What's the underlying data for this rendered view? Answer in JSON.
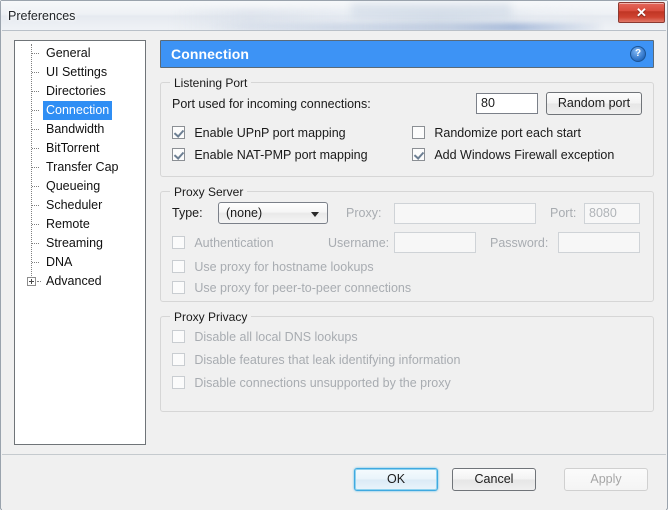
{
  "window": {
    "title": "Preferences",
    "close_label": "✕"
  },
  "sidebar": {
    "items": [
      {
        "label": "General",
        "selected": false,
        "expander": false
      },
      {
        "label": "UI Settings",
        "selected": false,
        "expander": false
      },
      {
        "label": "Directories",
        "selected": false,
        "expander": false
      },
      {
        "label": "Connection",
        "selected": true,
        "expander": false
      },
      {
        "label": "Bandwidth",
        "selected": false,
        "expander": false
      },
      {
        "label": "BitTorrent",
        "selected": false,
        "expander": false
      },
      {
        "label": "Transfer Cap",
        "selected": false,
        "expander": false
      },
      {
        "label": "Queueing",
        "selected": false,
        "expander": false
      },
      {
        "label": "Scheduler",
        "selected": false,
        "expander": false
      },
      {
        "label": "Remote",
        "selected": false,
        "expander": false
      },
      {
        "label": "Streaming",
        "selected": false,
        "expander": false
      },
      {
        "label": "DNA",
        "selected": false,
        "expander": false
      },
      {
        "label": "Advanced",
        "selected": false,
        "expander": true
      }
    ]
  },
  "page": {
    "header_title": "Connection",
    "help_icon": "?",
    "accent_color": "#3d93f5"
  },
  "listening_port": {
    "legend": "Listening Port",
    "port_label": "Port used for incoming connections:",
    "port_value": "80",
    "random_port_button": "Random port",
    "upnp_label": "Enable UPnP port mapping",
    "upnp_checked": true,
    "natpmp_label": "Enable NAT-PMP port mapping",
    "natpmp_checked": true,
    "randomize_label": "Randomize port each start",
    "randomize_checked": false,
    "firewall_label": "Add Windows Firewall exception",
    "firewall_checked": true
  },
  "proxy_server": {
    "legend": "Proxy Server",
    "type_label": "Type:",
    "type_value": "(none)",
    "proxy_label": "Proxy:",
    "proxy_value": "",
    "port_label": "Port:",
    "port_value": "8080",
    "auth_label": "Authentication",
    "auth_checked": false,
    "username_label": "Username:",
    "username_value": "",
    "password_label": "Password:",
    "password_value": "",
    "hostname_label": "Use proxy for hostname lookups",
    "hostname_checked": false,
    "p2p_label": "Use proxy for peer-to-peer connections",
    "p2p_checked": false
  },
  "proxy_privacy": {
    "legend": "Proxy Privacy",
    "dns_label": "Disable all local DNS lookups",
    "dns_checked": false,
    "leak_label": "Disable features that leak identifying information",
    "leak_checked": false,
    "unsupported_label": "Disable connections unsupported by the proxy",
    "unsupported_checked": false
  },
  "buttons": {
    "ok": "OK",
    "cancel": "Cancel",
    "apply": "Apply"
  }
}
